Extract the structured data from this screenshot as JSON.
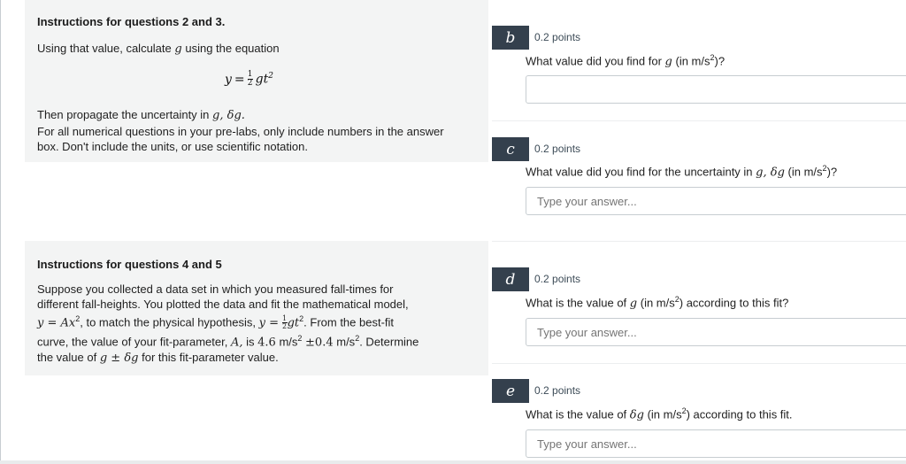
{
  "panel1": {
    "title": "Instructions for questions 2 and 3.",
    "intro": "Using that value, calculate",
    "intro_var": "g",
    "intro_tail": "using the equation",
    "eq_lhs": "y",
    "eq_eq": "=",
    "eq_num": "1",
    "eq_den": "2",
    "eq_rhs": "gt",
    "eq_exp": "2",
    "line1": "Then propagate the uncertainty in",
    "line1_var": "g, δg.",
    "line2": "For all numerical questions in your pre-labs, only include numbers in the answer",
    "line3": "box. Don't include the units, or use scientific notation."
  },
  "panel2": {
    "title": "Instructions for questions 4 and 5",
    "l1": "Suppose you collected a data set in which you measured fall-times for",
    "l2": "different fall-heights. You plotted the data and fit the mathematical model,",
    "l3_math1": "y = Ax",
    "l3_exp1": "2",
    "l3_mid": ", to match the physical hypothesis,",
    "l3_math2": "y =",
    "l3_num": "1",
    "l3_den": "2",
    "l3_math3": "gt",
    "l3_exp2": "2",
    "l3_tail": ". From the best-fit",
    "l4_a": "curve, the value of your fit-parameter,",
    "l4_var": "A,",
    "l4_is": "is",
    "l4_val": "4.6",
    "l4_unit1": "m/s",
    "l4_exp1": "2",
    "l4_pm": "±0.4",
    "l4_unit2": "m/s",
    "l4_exp2": "2",
    "l4_tail": ". Determine",
    "l5_a": "the value of",
    "l5_math": "g ± δg",
    "l5_tail": "for this fit-parameter value."
  },
  "questions": [
    {
      "label": "b",
      "points": "0.2 points",
      "text_a": "What value did you find for",
      "text_var": "g",
      "text_b": "(in m/s",
      "text_exp": "2",
      "text_c": ")?",
      "value": "",
      "placeholder": ""
    },
    {
      "label": "c",
      "points": "0.2 points",
      "text_a": "What value did you find for the uncertainty in",
      "text_var": "g, δg",
      "text_b": "(in m/s",
      "text_exp": "2",
      "text_c": ")?",
      "value": "",
      "placeholder": "Type your answer..."
    },
    {
      "label": "d",
      "points": "0.2 points",
      "text_a": "What is the value of",
      "text_var": "g",
      "text_b": "(in m/s",
      "text_exp": "2",
      "text_c": ") according to this fit?",
      "value": "",
      "placeholder": "Type your answer..."
    },
    {
      "label": "e",
      "points": "0.2 points",
      "text_a": "What is the value of",
      "text_var": "δg",
      "text_b": "(in m/s",
      "text_exp": "2",
      "text_c": ") according to this fit.",
      "value": "",
      "placeholder": "Type your answer..."
    }
  ]
}
